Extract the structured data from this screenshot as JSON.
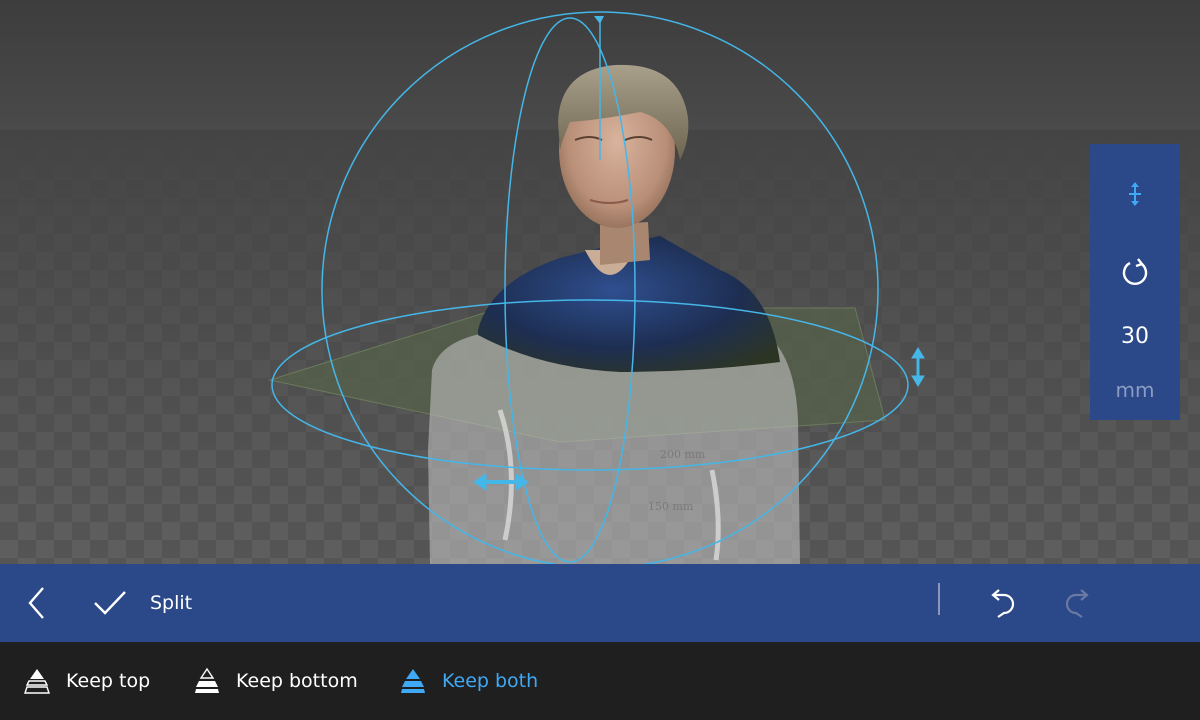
{
  "scene": {
    "bust_label_a": "200 mm",
    "bust_label_b": "150 mm"
  },
  "side_panel": {
    "move_icon": "move-arrows-icon",
    "rotate_icon": "rotate-icon",
    "value": "30",
    "unit": "mm"
  },
  "command_bar": {
    "back_icon": "chevron-left-icon",
    "confirm_icon": "checkmark-icon",
    "split_label": "Split",
    "undo_icon": "undo-icon",
    "redo_icon": "redo-icon"
  },
  "options": [
    {
      "label": "Keep top",
      "icon": "keep-top-icon",
      "active": false
    },
    {
      "label": "Keep bottom",
      "icon": "keep-bottom-icon",
      "active": false
    },
    {
      "label": "Keep both",
      "icon": "keep-both-icon",
      "active": true
    }
  ],
  "colors": {
    "accent": "#3fa9f5",
    "bar_blue": "#2b4889",
    "options_bg": "#1f1f1f",
    "gizmo": "#45b6e8"
  }
}
